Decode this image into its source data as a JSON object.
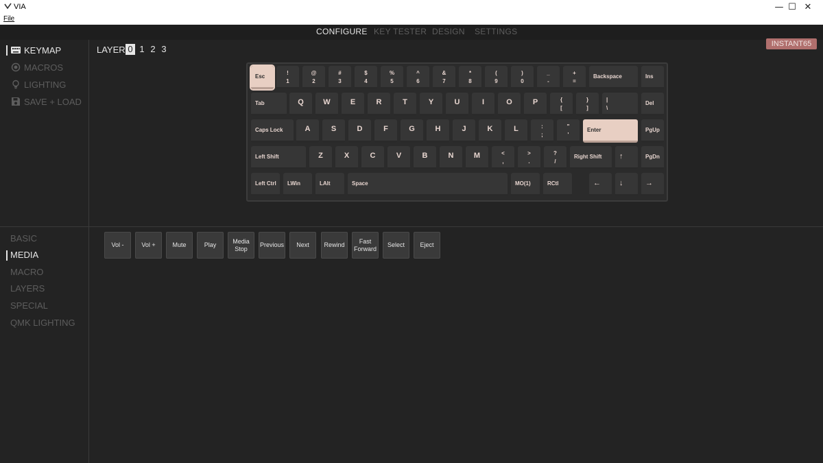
{
  "window": {
    "title": "VIA",
    "controls": [
      "—",
      "☐",
      "✕"
    ]
  },
  "menu": {
    "file": "File"
  },
  "topnav": {
    "configure": "CONFIGURE",
    "key_tester": "KEY TESTER",
    "design": "DESIGN",
    "settings": "SETTINGS"
  },
  "sidebar": {
    "keymap": "KEYMAP",
    "macros": "MACROS",
    "lighting": "LIGHTING",
    "save_load": "SAVE + LOAD"
  },
  "layers": {
    "label": "LAYER",
    "items": [
      "0",
      "1",
      "2",
      "3"
    ],
    "active": "0"
  },
  "device": {
    "name": "INSTANT65"
  },
  "categories": {
    "basic": "BASIC",
    "media": "MEDIA",
    "macro": "MACRO",
    "layers": "LAYERS",
    "special": "SPECIAL",
    "qmk_lighting": "QMK LIGHTING"
  },
  "keyboard": {
    "accent_color": "#e8cfc3",
    "keys": {
      "esc": "Esc",
      "backspace": "Backspace",
      "ins": "Ins",
      "tab": "Tab",
      "del": "Del",
      "caps": "Caps Lock",
      "enter": "Enter",
      "pgup": "PgUp",
      "lshift": "Left Shift",
      "rshift": "Right Shift",
      "pgdn": "PgDn",
      "lctrl": "Left Ctrl",
      "lwin": "LWin",
      "lalt": "LAlt",
      "space": "Space",
      "mo1": "MO(1)",
      "rctl": "RCtl",
      "up": "↑",
      "left": "←",
      "down": "↓",
      "right": "→",
      "num": [
        [
          "!",
          "1"
        ],
        [
          "@",
          "2"
        ],
        [
          "#",
          "3"
        ],
        [
          "$",
          "4"
        ],
        [
          "%",
          "5"
        ],
        [
          "^",
          "6"
        ],
        [
          "&",
          "7"
        ],
        [
          "*",
          "8"
        ],
        [
          "(",
          "9"
        ],
        [
          ")",
          "0"
        ],
        [
          "_",
          "-"
        ],
        [
          "+",
          "="
        ]
      ],
      "row2": [
        "Q",
        "W",
        "E",
        "R",
        "T",
        "Y",
        "U",
        "I",
        "O",
        "P"
      ],
      "row2_sym": [
        [
          "{",
          "["
        ],
        [
          "}",
          "]"
        ],
        [
          "|",
          "\\"
        ]
      ],
      "row3": [
        "A",
        "S",
        "D",
        "F",
        "G",
        "H",
        "J",
        "K",
        "L"
      ],
      "row3_sym": [
        [
          ":",
          ";"
        ],
        [
          "\"",
          "'"
        ]
      ],
      "row4": [
        "Z",
        "X",
        "C",
        "V",
        "B",
        "N",
        "M"
      ],
      "row4_sym": [
        [
          "<",
          ","
        ],
        [
          ">",
          "."
        ],
        [
          "?",
          "/"
        ]
      ]
    }
  },
  "media_buttons": [
    "Vol -",
    "Vol +",
    "Mute",
    "Play",
    "Media Stop",
    "Previous",
    "Next",
    "Rewind",
    "Fast Forward",
    "Select",
    "Eject"
  ]
}
